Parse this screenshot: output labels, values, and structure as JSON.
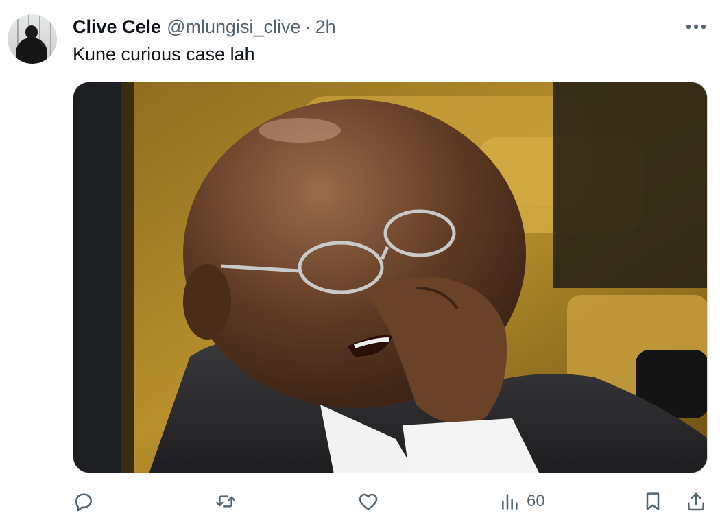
{
  "tweet": {
    "author_name": "Clive Cele",
    "handle": "@mlungisi_clive",
    "separator": "·",
    "time": "2h",
    "text": "Kune curious case lah",
    "more_icon": "more-icon"
  },
  "actions": {
    "reply_icon": "reply-icon",
    "retweet_icon": "retweet-icon",
    "like_icon": "heart-icon",
    "views_icon": "analytics-icon",
    "views_count": "60",
    "bookmark_icon": "bookmark-icon",
    "share_icon": "share-icon"
  },
  "colors": {
    "text_primary": "#0f1419",
    "text_secondary": "#536471",
    "border": "#cfd9de"
  }
}
